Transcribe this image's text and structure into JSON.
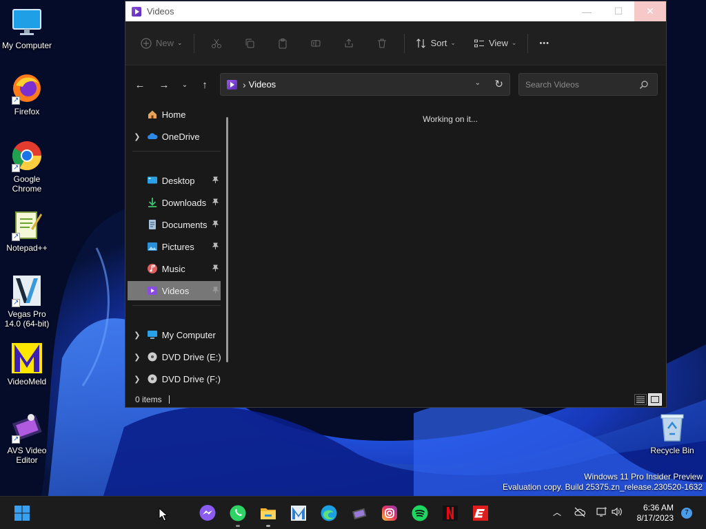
{
  "desktop": {
    "icons": [
      {
        "label": "My Computer",
        "icon": "monitor-icon"
      },
      {
        "label": "Firefox",
        "icon": "firefox-icon"
      },
      {
        "label": "Google Chrome",
        "icon": "chrome-icon"
      },
      {
        "label": "Notepad++",
        "icon": "notepadpp-icon"
      },
      {
        "label": "Vegas Pro 14.0 (64-bit)",
        "icon": "vegas-icon"
      },
      {
        "label": "VideoMeld",
        "icon": "videomeld-icon"
      },
      {
        "label": "AVS Video Editor",
        "icon": "avs-icon"
      },
      {
        "label": "Recycle Bin",
        "icon": "recycle-bin-icon"
      }
    ],
    "watermark": {
      "line1": "Windows 11 Pro Insider Preview",
      "line2": "Evaluation copy. Build 25375.zn_release.230520-1632"
    }
  },
  "explorer": {
    "title": "Videos",
    "window_controls": {
      "minimize": "—",
      "maximize": "☐",
      "close": "✕"
    },
    "toolbar": {
      "new_label": "New",
      "sort_label": "Sort",
      "view_label": "View",
      "more_label": "•••",
      "disabled_actions": [
        "cut-icon",
        "copy-icon",
        "paste-icon",
        "rename-icon",
        "share-icon",
        "delete-icon"
      ]
    },
    "address": {
      "separator": "›",
      "path": "Videos"
    },
    "search": {
      "placeholder": "Search Videos"
    },
    "nav": {
      "home": "Home",
      "onedrive": "OneDrive",
      "desktop": "Desktop",
      "downloads": "Downloads",
      "documents": "Documents",
      "pictures": "Pictures",
      "music": "Music",
      "videos": "Videos",
      "my_computer": "My Computer",
      "dvd_e": "DVD Drive (E:) Sa",
      "dvd_f": "DVD Drive (F:) Sa",
      "selected": "Videos"
    },
    "content": {
      "status_message": "Working on it..."
    },
    "statusbar": {
      "items": "0 items"
    }
  },
  "taskbar": {
    "apps": [
      "start-icon",
      "messenger-icon",
      "whatsapp-icon",
      "file-explorer-icon",
      "videomeld-icon",
      "edge-icon",
      "video-editor-icon",
      "instagram-icon",
      "spotify-icon",
      "netflix-icon",
      "espn-icon"
    ],
    "clock": {
      "time": "6:36 AM",
      "date": "8/17/2023"
    },
    "notifications": "7"
  },
  "colors": {
    "window_bg": "#191919",
    "toolbar_bg": "#202020",
    "selected_nav": "#777777",
    "taskbar_bg": "#1c1c1c",
    "wallpaper_blue": "#1f4fe0"
  }
}
